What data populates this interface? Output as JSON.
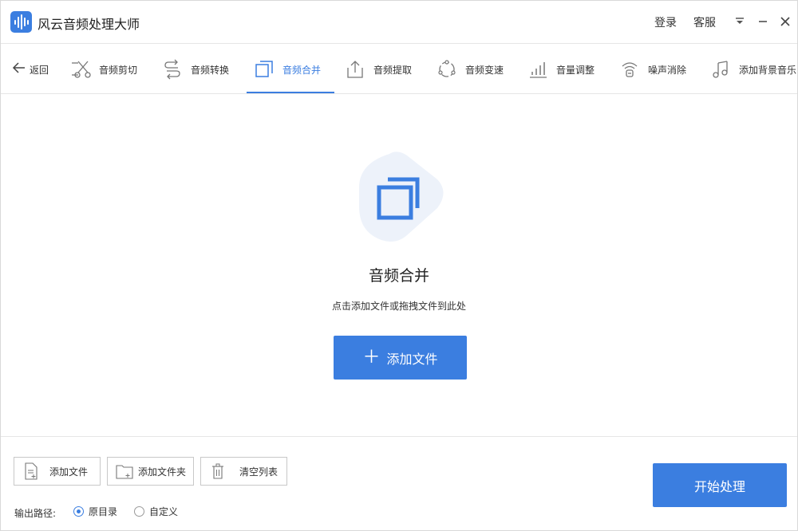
{
  "app": {
    "title": "风云音频处理大师",
    "accent": "#3b7ee0"
  },
  "titlebar": {
    "login": "登录",
    "service": "客服",
    "icons": [
      "dropdown-menu-icon",
      "minimize-icon",
      "close-icon"
    ]
  },
  "nav": {
    "back": "返回",
    "items": [
      {
        "label": "音频剪切",
        "icon": "scissors-icon"
      },
      {
        "label": "音频转换",
        "icon": "convert-arrows-icon"
      },
      {
        "label": "音频合并",
        "icon": "merge-squares-icon",
        "active": true
      },
      {
        "label": "音频提取",
        "icon": "upload-extract-icon"
      },
      {
        "label": "音频变速",
        "icon": "speed-circle-icon"
      },
      {
        "label": "音量调整",
        "icon": "volume-bars-icon"
      },
      {
        "label": "噪声消除",
        "icon": "noise-wave-icon"
      },
      {
        "label": "添加背景音乐",
        "icon": "music-note-icon"
      }
    ]
  },
  "main": {
    "title": "音频合并",
    "subtitle": "点击添加文件或拖拽文件到此处",
    "add_button": "添加文件",
    "add_button_icon": "plus-icon"
  },
  "bottom": {
    "add_file": "添加文件",
    "add_folder": "添加文件夹",
    "clear_list": "清空列表",
    "output_label": "输出路径:",
    "option_original": "原目录",
    "option_custom": "自定义",
    "selected": "原目录",
    "start": "开始处理"
  }
}
